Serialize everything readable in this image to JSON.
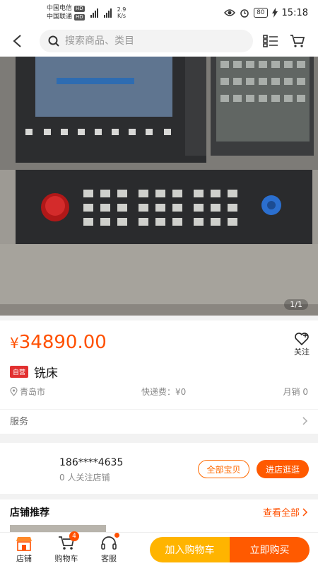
{
  "status_bar": {
    "carrier1": "中国电信",
    "carrier2": "中国联通",
    "hd": "HD",
    "net_speed_value": "2.9",
    "net_speed_unit": "K/s",
    "battery": "80",
    "time": "15:18",
    "icons": [
      "eye-icon",
      "alarm-icon",
      "charging-icon"
    ]
  },
  "nav": {
    "search_placeholder": "搜索商品、类目",
    "icons": [
      "back-icon",
      "search-icon",
      "menu-icon",
      "cart-icon"
    ]
  },
  "gallery": {
    "pager": "1/1"
  },
  "product": {
    "currency": "¥",
    "price": "34890.00",
    "follow_label": "关注",
    "badge": "自营",
    "title": "铣床",
    "location": "青岛市",
    "shipping": "快递费：¥0",
    "sales": "月销 0",
    "service_label": "服务"
  },
  "shop": {
    "phone": "186****4635",
    "fans": "0 人关注店铺",
    "all_items_label": "全部宝贝",
    "enter_shop_label": "进店逛逛"
  },
  "recommend": {
    "title": "店铺推荐",
    "view_all": "查看全部"
  },
  "bottom_bar": {
    "shop_label": "店铺",
    "cart_label": "购物车",
    "cart_count": "4",
    "service_label": "客服",
    "add_cart_label": "加入购物车",
    "buy_now_label": "立即购买"
  },
  "colors": {
    "accent": "#ff5000",
    "add_cart": "#ffb400",
    "buy_now": "#ff5a00"
  }
}
